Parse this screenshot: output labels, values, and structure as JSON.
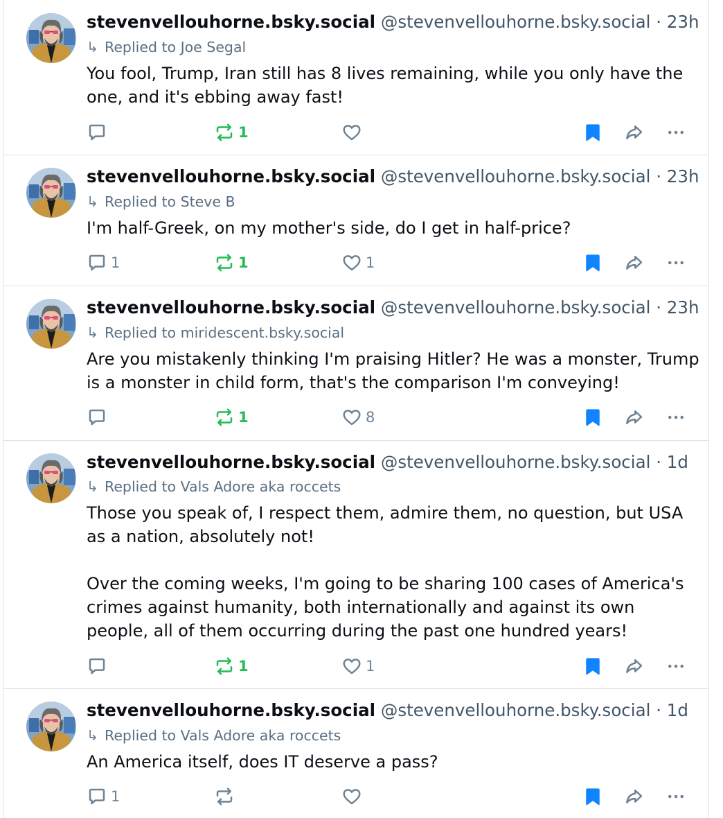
{
  "colors": {
    "accent_blue": "#1083fe",
    "repost_green": "#20bc55",
    "muted_text": "#425566",
    "icon_gray": "#6f8294",
    "divider": "#dbe1e7"
  },
  "posts": [
    {
      "display_name": "stevenvellouhorne.bsky.social",
      "handle": "@stevenvellouhorne.bsky.social",
      "separator": "·",
      "time": "23h",
      "reply_prefix": "Replied to",
      "reply_to": "Joe Segal",
      "text": "You fool, Trump, Iran still has 8 lives remaining, while you only have the one, and it's ebbing away fast!",
      "reply_count": "",
      "repost_count": "1",
      "like_count": "",
      "bookmarked": true
    },
    {
      "display_name": "stevenvellouhorne.bsky.social",
      "handle": "@stevenvellouhorne.bsky.social",
      "separator": "·",
      "time": "23h",
      "reply_prefix": "Replied to",
      "reply_to": "Steve B",
      "text": "I'm half-Greek, on my mother's side, do I get in half-price?",
      "reply_count": "1",
      "repost_count": "1",
      "like_count": "1",
      "bookmarked": true
    },
    {
      "display_name": "stevenvellouhorne.bsky.social",
      "handle": "@stevenvellouhorne.bsky.social",
      "separator": "·",
      "time": "23h",
      "reply_prefix": "Replied to",
      "reply_to": "miridescent.bsky.social",
      "text": "Are you mistakenly thinking I'm praising Hitler? He was a monster, Trump is a monster in child form, that's the comparison I'm conveying!",
      "reply_count": "",
      "repost_count": "1",
      "like_count": "8",
      "bookmarked": true
    },
    {
      "display_name": "stevenvellouhorne.bsky.social",
      "handle": "@stevenvellouhorne.bsky.social",
      "separator": "·",
      "time": "1d",
      "reply_prefix": "Replied to",
      "reply_to": "Vals Adore aka roccets",
      "text": "Those you speak of, I respect them, admire them, no question, but USA as a nation, absolutely not!\n\nOver the coming weeks, I'm going to be sharing 100 cases of America's crimes against humanity, both internationally and against its own people, all of them occurring during the past one hundred years!",
      "reply_count": "",
      "repost_count": "1",
      "like_count": "1",
      "bookmarked": true
    },
    {
      "display_name": "stevenvellouhorne.bsky.social",
      "handle": "@stevenvellouhorne.bsky.social",
      "separator": "·",
      "time": "1d",
      "reply_prefix": "Replied to",
      "reply_to": "Vals Adore aka roccets",
      "text": "An America itself, does IT deserve a pass?",
      "reply_count": "1",
      "repost_count": "",
      "like_count": "",
      "bookmarked": true
    }
  ]
}
